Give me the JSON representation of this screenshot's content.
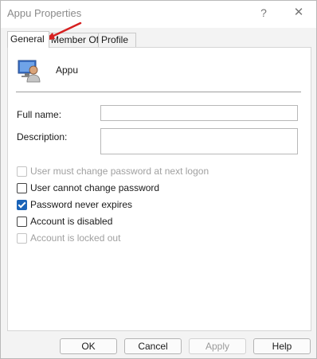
{
  "window": {
    "title": "Appu Properties",
    "help_glyph": "?",
    "close_glyph": "✕"
  },
  "tabs": [
    {
      "label": "General",
      "active": true
    },
    {
      "label": "Member Of",
      "active": false
    },
    {
      "label": "Profile",
      "active": false
    }
  ],
  "user": {
    "name": "Appu",
    "icon": "user-icon"
  },
  "fields": {
    "full_name_label": "Full name:",
    "full_name_value": "",
    "description_label": "Description:",
    "description_value": ""
  },
  "checkboxes": [
    {
      "label": "User must change password at next logon",
      "checked": false,
      "enabled": false
    },
    {
      "label": "User cannot change password",
      "checked": false,
      "enabled": true
    },
    {
      "label": "Password never expires",
      "checked": true,
      "enabled": true
    },
    {
      "label": "Account is disabled",
      "checked": false,
      "enabled": true
    },
    {
      "label": "Account is locked out",
      "checked": false,
      "enabled": false
    }
  ],
  "buttons": {
    "ok": "OK",
    "cancel": "Cancel",
    "apply": "Apply",
    "help": "Help"
  },
  "colors": {
    "accent": "#1a63b8",
    "annotation_arrow": "#d62020"
  }
}
